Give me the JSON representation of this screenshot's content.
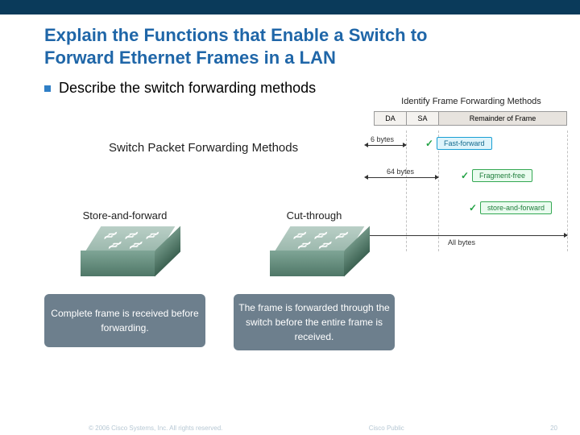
{
  "title_line1": "Explain the Functions that Enable a Switch to",
  "title_line2": "Forward Ethernet Frames in a LAN",
  "bullet": "Describe the switch forwarding methods",
  "subhead": "Switch Packet Forwarding Methods",
  "diagram": {
    "title": "Identify Frame Forwarding Methods",
    "da": "DA",
    "sa": "SA",
    "rest": "Remainder of Frame",
    "six_bytes": "6 bytes",
    "sixty_four": "64 bytes",
    "all_bytes": "All bytes",
    "fast_forward": "Fast-forward",
    "fragment_free": "Fragment-free",
    "store_and_forward": "store-and-forward"
  },
  "left_switch": {
    "label": "Store-and-forward",
    "caption": "Complete frame is received before forwarding."
  },
  "right_switch": {
    "label": "Cut-through",
    "caption": "The frame is forwarded through the switch before the entire frame is received."
  },
  "footer": {
    "copyright": "© 2006 Cisco Systems, Inc. All rights reserved.",
    "mark": "Cisco Public",
    "page": "20"
  }
}
